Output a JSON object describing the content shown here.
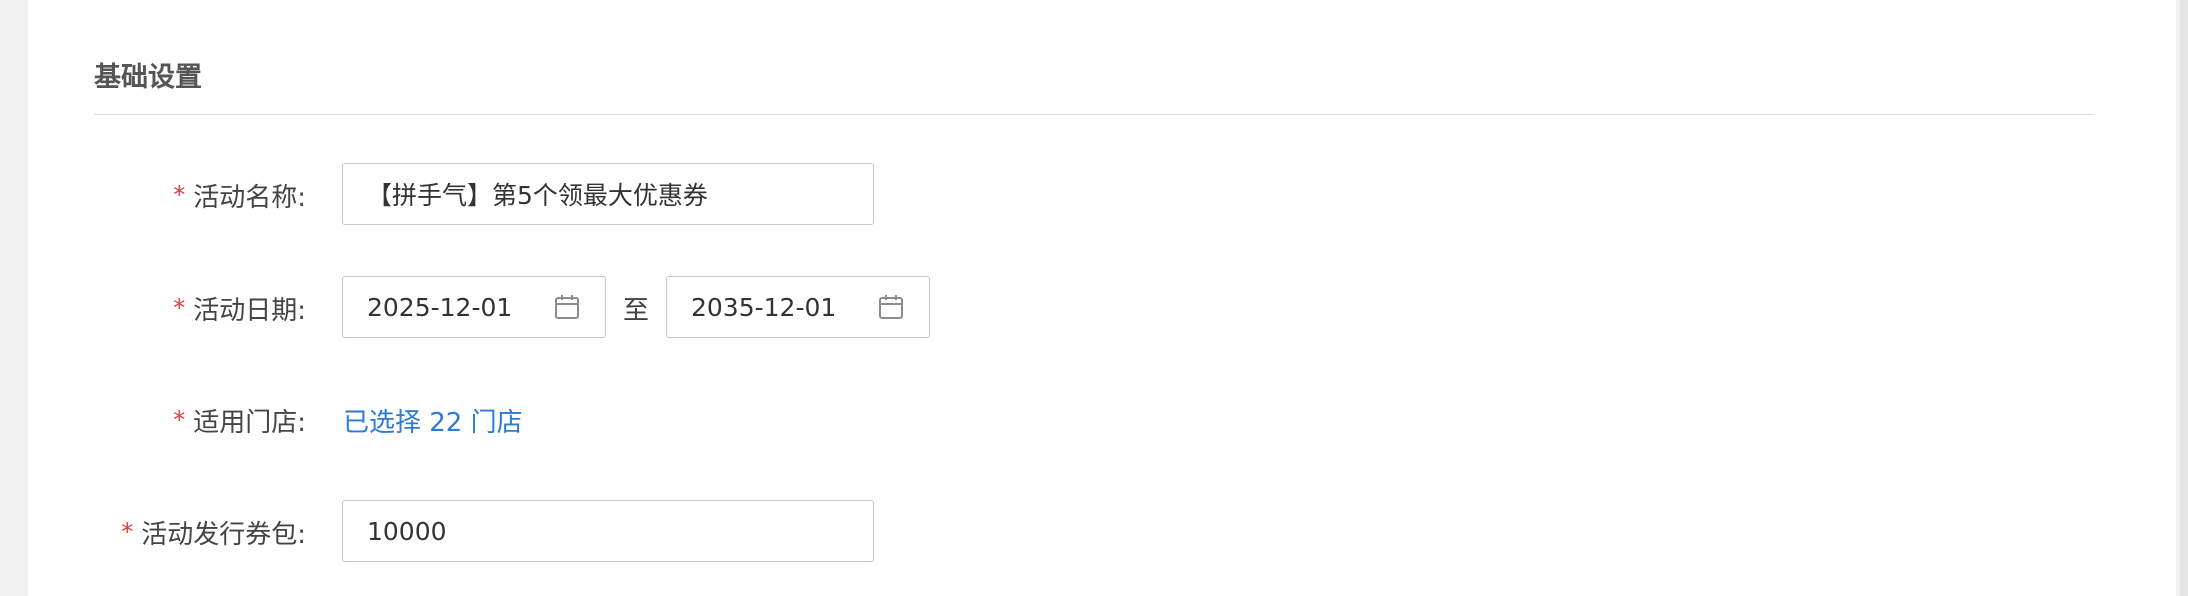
{
  "section": {
    "title": "基础设置"
  },
  "form": {
    "required_mark": "*",
    "activity_name": {
      "label": "活动名称:",
      "value": "【拼手气】第5个领最大优惠券"
    },
    "activity_date": {
      "label": "活动日期:",
      "start": "2025-12-01",
      "separator": "至",
      "end": "2035-12-01",
      "icon": "calendar-icon"
    },
    "stores": {
      "label": "适用门店:",
      "link_text": "已选择 22 门店",
      "link_color": "#2a7bd4"
    },
    "coupon_packs": {
      "label": "活动发行券包:",
      "value": "10000"
    }
  },
  "colors": {
    "required": "#e0393e",
    "link": "#2a7bd4"
  }
}
